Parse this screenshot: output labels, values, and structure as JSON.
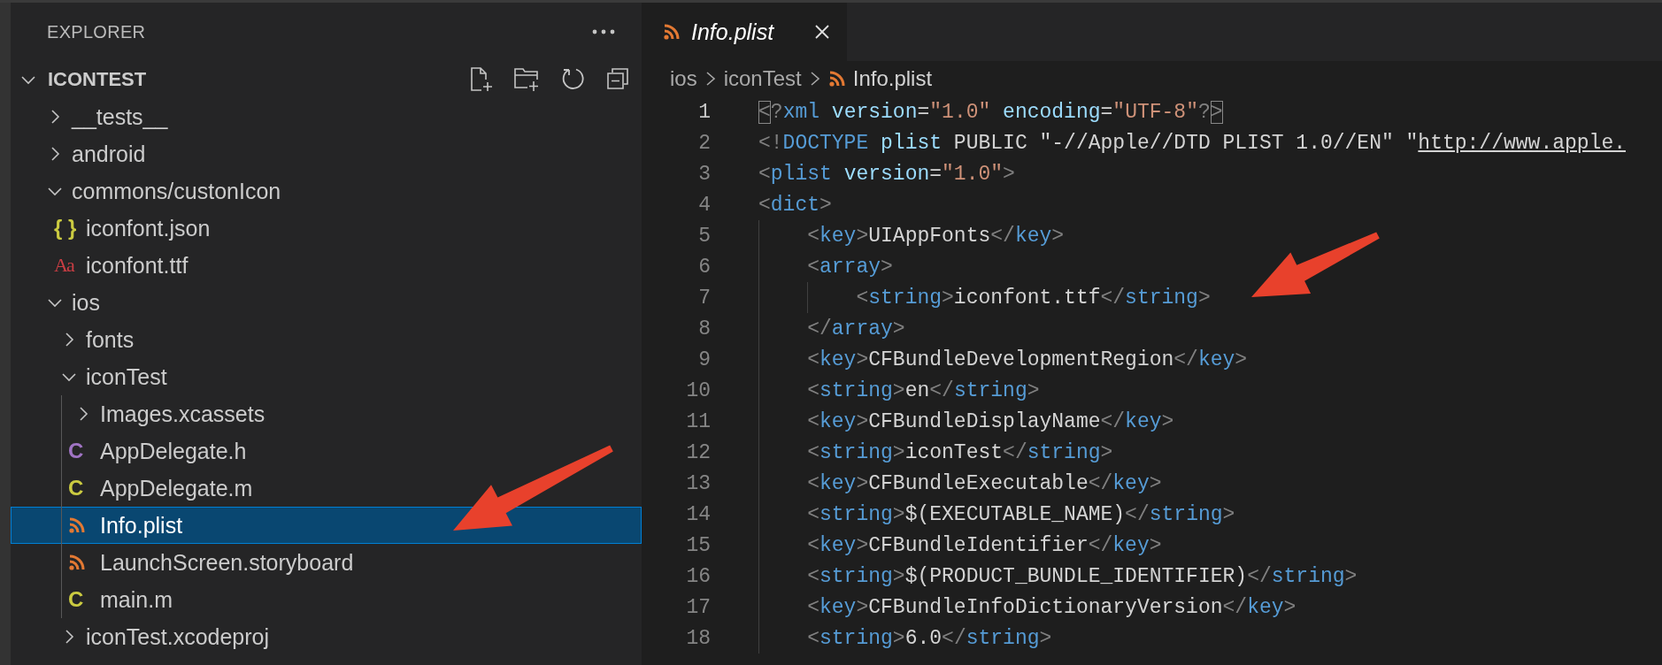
{
  "sidebar": {
    "title": "EXPLORER",
    "tree": {
      "label": "ICONTEST",
      "expanded": true,
      "children": [
        {
          "label": "__tests__",
          "kind": "folder",
          "expanded": false,
          "selected": false
        },
        {
          "label": "android",
          "kind": "folder",
          "expanded": false,
          "selected": false
        },
        {
          "label": "commons/custonIcon",
          "kind": "folder",
          "expanded": true,
          "selected": false,
          "children": [
            {
              "label": "iconfont.json",
              "kind": "file",
              "selected": false,
              "icon": {
                "kind": "glyph",
                "glyph": "{ }",
                "color": "#cbcb41"
              }
            },
            {
              "label": "iconfont.ttf",
              "kind": "file",
              "selected": false,
              "icon": {
                "kind": "serif-glyph",
                "glyph": "Aa",
                "color": "#cc3e44"
              }
            }
          ]
        },
        {
          "label": "ios",
          "kind": "folder",
          "expanded": true,
          "selected": false,
          "children": [
            {
              "label": "fonts",
              "kind": "folder",
              "expanded": false,
              "selected": false
            },
            {
              "label": "iconTest",
              "kind": "folder",
              "expanded": true,
              "selected": false,
              "children": [
                {
                  "label": "Images.xcassets",
                  "kind": "folder",
                  "expanded": false,
                  "selected": false
                },
                {
                  "label": "AppDelegate.h",
                  "kind": "file",
                  "selected": false,
                  "icon": {
                    "kind": "glyph",
                    "glyph": "C",
                    "color": "#a074c4"
                  }
                },
                {
                  "label": "AppDelegate.m",
                  "kind": "file",
                  "selected": false,
                  "icon": {
                    "kind": "glyph",
                    "glyph": "C",
                    "color": "#cbcb41"
                  }
                },
                {
                  "label": "Info.plist",
                  "kind": "file",
                  "selected": true,
                  "icon": {
                    "kind": "feed",
                    "color": "#e37933"
                  }
                },
                {
                  "label": "LaunchScreen.storyboard",
                  "kind": "file",
                  "selected": false,
                  "icon": {
                    "kind": "feed",
                    "color": "#e37933"
                  }
                },
                {
                  "label": "main.m",
                  "kind": "file",
                  "selected": false,
                  "icon": {
                    "kind": "glyph",
                    "glyph": "C",
                    "color": "#cbcb41"
                  }
                }
              ]
            },
            {
              "label": "iconTest.xcodeproj",
              "kind": "folder",
              "expanded": false,
              "selected": false
            }
          ]
        }
      ]
    }
  },
  "editor": {
    "tabs": [
      {
        "label": "Info.plist",
        "selected": true,
        "icon": {
          "kind": "feed",
          "color": "#e37933"
        }
      }
    ],
    "breadcrumb": [
      "ios",
      "iconTest",
      "Info.plist"
    ],
    "lines": [
      {
        "number": "1",
        "current": true,
        "in_block": false,
        "in_inner_block": false,
        "tokens": [
          {
            "kind": "match",
            "text": "<"
          },
          {
            "kind": "punct",
            "text": "?"
          },
          {
            "kind": "tag",
            "text": "xml"
          },
          {
            "kind": "attr",
            "text": " version"
          },
          {
            "kind": "text",
            "text": "="
          },
          {
            "kind": "string",
            "text": "\"1.0\""
          },
          {
            "kind": "attr",
            "text": " encoding"
          },
          {
            "kind": "text",
            "text": "="
          },
          {
            "kind": "string",
            "text": "\"UTF-8\""
          },
          {
            "kind": "punct",
            "text": "?"
          },
          {
            "kind": "match",
            "text": ">"
          }
        ]
      },
      {
        "number": "2",
        "current": false,
        "in_block": false,
        "in_inner_block": false,
        "tokens": [
          {
            "kind": "punct",
            "text": "<!"
          },
          {
            "kind": "tag",
            "text": "DOCTYPE"
          },
          {
            "kind": "attr",
            "text": " plist"
          },
          {
            "kind": "text",
            "text": " PUBLIC \"-//Apple//DTD PLIST 1.0//EN\" \""
          },
          {
            "kind": "link",
            "text": "http://www.apple."
          }
        ]
      },
      {
        "number": "3",
        "current": false,
        "in_block": false,
        "in_inner_block": false,
        "tokens": [
          {
            "kind": "punct",
            "text": "<"
          },
          {
            "kind": "tag",
            "text": "plist"
          },
          {
            "kind": "attr",
            "text": " version"
          },
          {
            "kind": "text",
            "text": "="
          },
          {
            "kind": "string",
            "text": "\"1.0\""
          },
          {
            "kind": "punct",
            "text": ">"
          }
        ]
      },
      {
        "number": "4",
        "current": false,
        "in_block": false,
        "in_inner_block": false,
        "tokens": [
          {
            "kind": "punct",
            "text": "<"
          },
          {
            "kind": "tag",
            "text": "dict"
          },
          {
            "kind": "punct",
            "text": ">"
          }
        ]
      },
      {
        "number": "5",
        "current": false,
        "in_block": true,
        "in_inner_block": false,
        "tokens": [
          {
            "kind": "punct",
            "text": "<"
          },
          {
            "kind": "tag",
            "text": "key"
          },
          {
            "kind": "punct",
            "text": ">"
          },
          {
            "kind": "text",
            "text": "UIAppFonts"
          },
          {
            "kind": "punct",
            "text": "</"
          },
          {
            "kind": "tag",
            "text": "key"
          },
          {
            "kind": "punct",
            "text": ">"
          }
        ]
      },
      {
        "number": "6",
        "current": false,
        "in_block": true,
        "in_inner_block": false,
        "tokens": [
          {
            "kind": "punct",
            "text": "<"
          },
          {
            "kind": "tag",
            "text": "array"
          },
          {
            "kind": "punct",
            "text": ">"
          }
        ]
      },
      {
        "number": "7",
        "current": false,
        "in_block": true,
        "in_inner_block": true,
        "tokens": [
          {
            "kind": "punct",
            "text": "<"
          },
          {
            "kind": "tag",
            "text": "string"
          },
          {
            "kind": "punct",
            "text": ">"
          },
          {
            "kind": "text",
            "text": "iconfont.ttf"
          },
          {
            "kind": "punct",
            "text": "</"
          },
          {
            "kind": "tag",
            "text": "string"
          },
          {
            "kind": "punct",
            "text": ">"
          }
        ]
      },
      {
        "number": "8",
        "current": false,
        "in_block": true,
        "in_inner_block": false,
        "tokens": [
          {
            "kind": "punct",
            "text": "</"
          },
          {
            "kind": "tag",
            "text": "array"
          },
          {
            "kind": "punct",
            "text": ">"
          }
        ]
      },
      {
        "number": "9",
        "current": false,
        "in_block": true,
        "in_inner_block": false,
        "tokens": [
          {
            "kind": "punct",
            "text": "<"
          },
          {
            "kind": "tag",
            "text": "key"
          },
          {
            "kind": "punct",
            "text": ">"
          },
          {
            "kind": "text",
            "text": "CFBundleDevelopmentRegion"
          },
          {
            "kind": "punct",
            "text": "</"
          },
          {
            "kind": "tag",
            "text": "key"
          },
          {
            "kind": "punct",
            "text": ">"
          }
        ]
      },
      {
        "number": "10",
        "current": false,
        "in_block": true,
        "in_inner_block": false,
        "tokens": [
          {
            "kind": "punct",
            "text": "<"
          },
          {
            "kind": "tag",
            "text": "string"
          },
          {
            "kind": "punct",
            "text": ">"
          },
          {
            "kind": "text",
            "text": "en"
          },
          {
            "kind": "punct",
            "text": "</"
          },
          {
            "kind": "tag",
            "text": "string"
          },
          {
            "kind": "punct",
            "text": ">"
          }
        ]
      },
      {
        "number": "11",
        "current": false,
        "in_block": true,
        "in_inner_block": false,
        "tokens": [
          {
            "kind": "punct",
            "text": "<"
          },
          {
            "kind": "tag",
            "text": "key"
          },
          {
            "kind": "punct",
            "text": ">"
          },
          {
            "kind": "text",
            "text": "CFBundleDisplayName"
          },
          {
            "kind": "punct",
            "text": "</"
          },
          {
            "kind": "tag",
            "text": "key"
          },
          {
            "kind": "punct",
            "text": ">"
          }
        ]
      },
      {
        "number": "12",
        "current": false,
        "in_block": true,
        "in_inner_block": false,
        "tokens": [
          {
            "kind": "punct",
            "text": "<"
          },
          {
            "kind": "tag",
            "text": "string"
          },
          {
            "kind": "punct",
            "text": ">"
          },
          {
            "kind": "text",
            "text": "iconTest"
          },
          {
            "kind": "punct",
            "text": "</"
          },
          {
            "kind": "tag",
            "text": "string"
          },
          {
            "kind": "punct",
            "text": ">"
          }
        ]
      },
      {
        "number": "13",
        "current": false,
        "in_block": true,
        "in_inner_block": false,
        "tokens": [
          {
            "kind": "punct",
            "text": "<"
          },
          {
            "kind": "tag",
            "text": "key"
          },
          {
            "kind": "punct",
            "text": ">"
          },
          {
            "kind": "text",
            "text": "CFBundleExecutable"
          },
          {
            "kind": "punct",
            "text": "</"
          },
          {
            "kind": "tag",
            "text": "key"
          },
          {
            "kind": "punct",
            "text": ">"
          }
        ]
      },
      {
        "number": "14",
        "current": false,
        "in_block": true,
        "in_inner_block": false,
        "tokens": [
          {
            "kind": "punct",
            "text": "<"
          },
          {
            "kind": "tag",
            "text": "string"
          },
          {
            "kind": "punct",
            "text": ">"
          },
          {
            "kind": "text",
            "text": "$(EXECUTABLE_NAME)"
          },
          {
            "kind": "punct",
            "text": "</"
          },
          {
            "kind": "tag",
            "text": "string"
          },
          {
            "kind": "punct",
            "text": ">"
          }
        ]
      },
      {
        "number": "15",
        "current": false,
        "in_block": true,
        "in_inner_block": false,
        "tokens": [
          {
            "kind": "punct",
            "text": "<"
          },
          {
            "kind": "tag",
            "text": "key"
          },
          {
            "kind": "punct",
            "text": ">"
          },
          {
            "kind": "text",
            "text": "CFBundleIdentifier"
          },
          {
            "kind": "punct",
            "text": "</"
          },
          {
            "kind": "tag",
            "text": "key"
          },
          {
            "kind": "punct",
            "text": ">"
          }
        ]
      },
      {
        "number": "16",
        "current": false,
        "in_block": true,
        "in_inner_block": false,
        "tokens": [
          {
            "kind": "punct",
            "text": "<"
          },
          {
            "kind": "tag",
            "text": "string"
          },
          {
            "kind": "punct",
            "text": ">"
          },
          {
            "kind": "text",
            "text": "$(PRODUCT_BUNDLE_IDENTIFIER)"
          },
          {
            "kind": "punct",
            "text": "</"
          },
          {
            "kind": "tag",
            "text": "string"
          },
          {
            "kind": "punct",
            "text": ">"
          }
        ]
      },
      {
        "number": "17",
        "current": false,
        "in_block": true,
        "in_inner_block": false,
        "tokens": [
          {
            "kind": "punct",
            "text": "<"
          },
          {
            "kind": "tag",
            "text": "key"
          },
          {
            "kind": "punct",
            "text": ">"
          },
          {
            "kind": "text",
            "text": "CFBundleInfoDictionaryVersion"
          },
          {
            "kind": "punct",
            "text": "</"
          },
          {
            "kind": "tag",
            "text": "key"
          },
          {
            "kind": "punct",
            "text": ">"
          }
        ]
      },
      {
        "number": "18",
        "current": false,
        "in_block": true,
        "in_inner_block": false,
        "tokens": [
          {
            "kind": "punct",
            "text": "<"
          },
          {
            "kind": "tag",
            "text": "string"
          },
          {
            "kind": "punct",
            "text": ">"
          },
          {
            "kind": "text",
            "text": "6.0"
          },
          {
            "kind": "punct",
            "text": "</"
          },
          {
            "kind": "tag",
            "text": "string"
          },
          {
            "kind": "punct",
            "text": ">"
          }
        ]
      }
    ]
  }
}
